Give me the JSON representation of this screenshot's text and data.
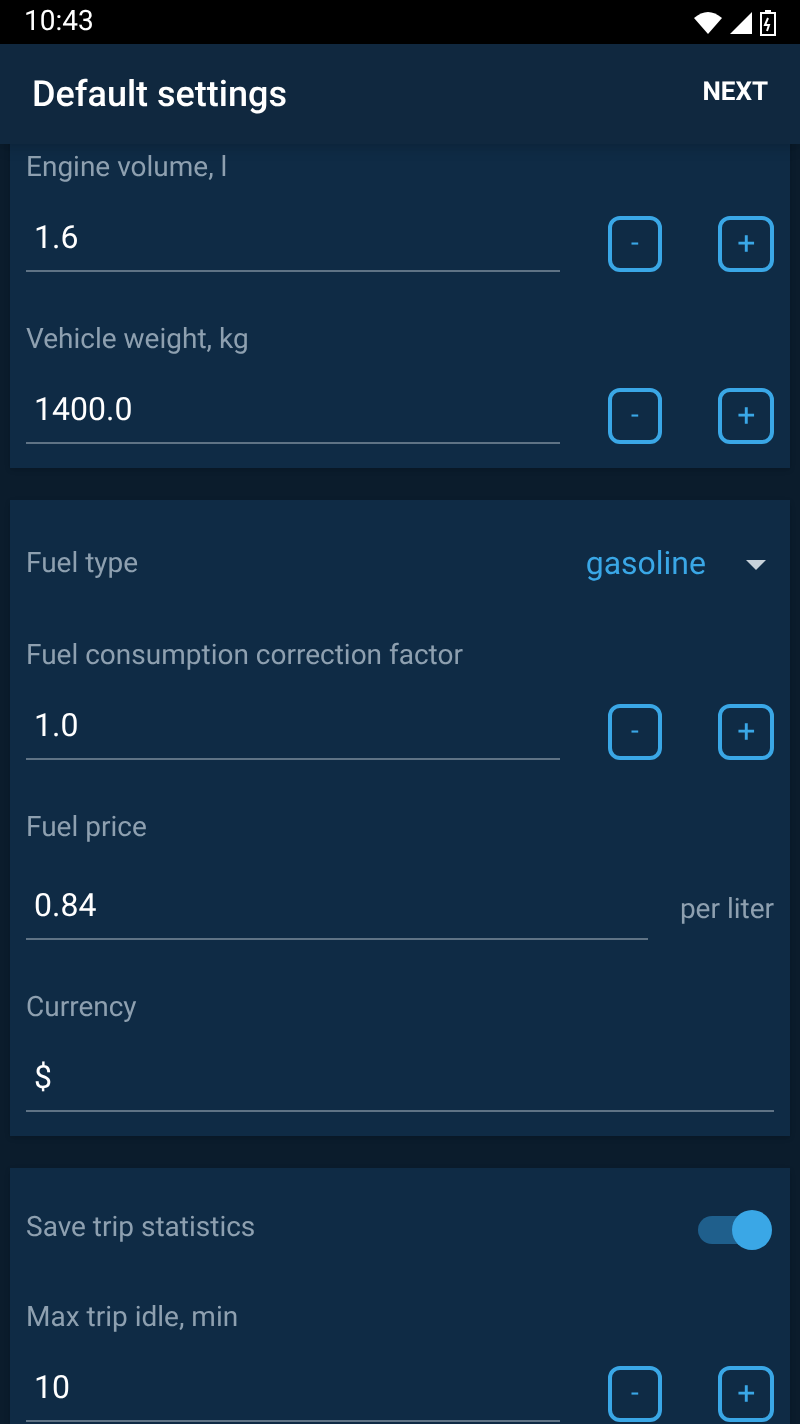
{
  "status_bar": {
    "time": "10:43"
  },
  "app_bar": {
    "title": "Default settings",
    "action": "NEXT"
  },
  "cards": [
    {
      "rows": [
        {
          "kind": "stepper",
          "label": "Engine volume, l",
          "value": "1.6",
          "minus": "-",
          "plus": "+"
        },
        {
          "kind": "stepper",
          "label": "Vehicle weight, kg",
          "value": "1400.0",
          "minus": "-",
          "plus": "+"
        }
      ]
    },
    {
      "rows": [
        {
          "kind": "dropdown",
          "label": "Fuel type",
          "value": "gasoline"
        },
        {
          "kind": "stepper",
          "label": "Fuel consumption correction factor",
          "value": "1.0",
          "minus": "-",
          "plus": "+"
        },
        {
          "kind": "unit",
          "label": "Fuel price",
          "value": "0.84",
          "unit": "per liter"
        },
        {
          "kind": "text",
          "label": "Currency",
          "value": "$"
        }
      ]
    },
    {
      "rows": [
        {
          "kind": "switch",
          "label": "Save trip statistics",
          "on": true
        },
        {
          "kind": "stepper",
          "label": "Max trip idle, min",
          "value": "10",
          "minus": "-",
          "plus": "+"
        }
      ]
    }
  ]
}
